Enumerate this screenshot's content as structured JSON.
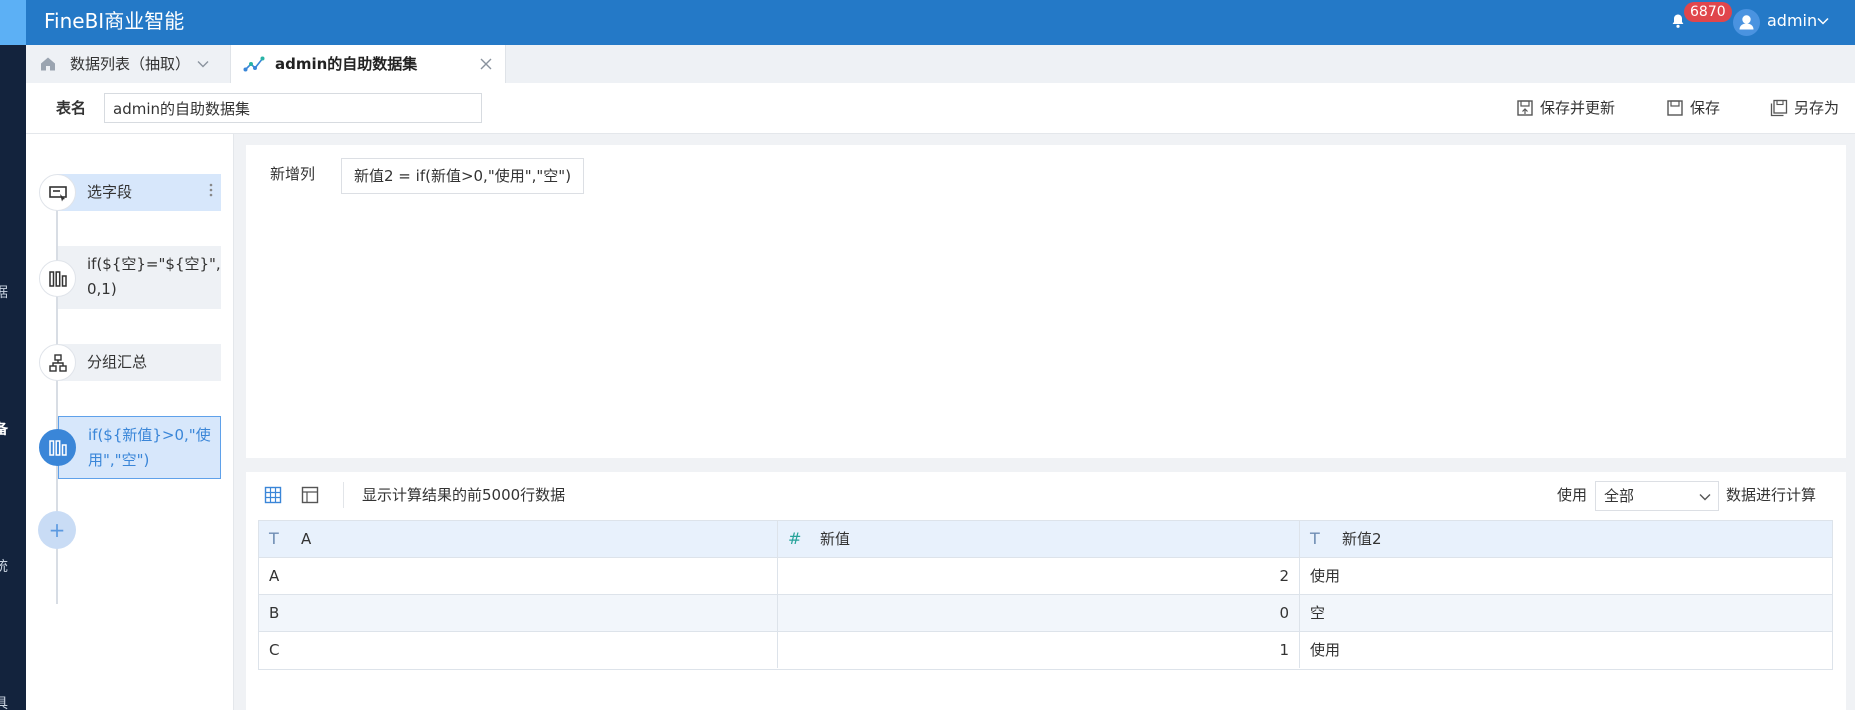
{
  "app": {
    "title": "FineBI商业智能"
  },
  "header": {
    "notification_count": "6870",
    "user_name": "admin"
  },
  "left_rail": {
    "fragments": [
      "据",
      "备",
      "统",
      "具"
    ]
  },
  "tabs": [
    {
      "label": "数据列表（抽取）"
    },
    {
      "label": "admin的自助数据集"
    }
  ],
  "name_bar": {
    "label": "表名",
    "value": "admin的自助数据集",
    "actions": [
      "保存并更新",
      "保存",
      "另存为"
    ]
  },
  "steps": [
    {
      "label": "选字段"
    },
    {
      "label_line1": "if(${空}=\"${空}\",",
      "label_line2": "0,1)"
    },
    {
      "label": "分组汇总"
    },
    {
      "label_line1": "if(${新值}>0,\"使",
      "label_line2": "用\",\"空\")"
    }
  ],
  "config": {
    "label": "新增列",
    "formula": "新值2 = if(新值>0,\"使用\",\"空\")"
  },
  "preview": {
    "info": "显示计算结果的前5000行数据",
    "use_label": "使用",
    "scope_value": "全部",
    "calc_label": "数据进行计算",
    "columns": [
      {
        "type_icon": "T",
        "name": "A"
      },
      {
        "type_icon": "#",
        "name": "新值"
      },
      {
        "type_icon": "T",
        "name": "新值2"
      }
    ],
    "rows": [
      [
        "A",
        "2",
        "使用"
      ],
      [
        "B",
        "0",
        "空"
      ],
      [
        "C",
        "1",
        "使用"
      ]
    ]
  },
  "colors": {
    "topbar": "#2479c7",
    "rail": "#13233d",
    "accent": "#3a86d8",
    "badge": "#e0464c"
  }
}
